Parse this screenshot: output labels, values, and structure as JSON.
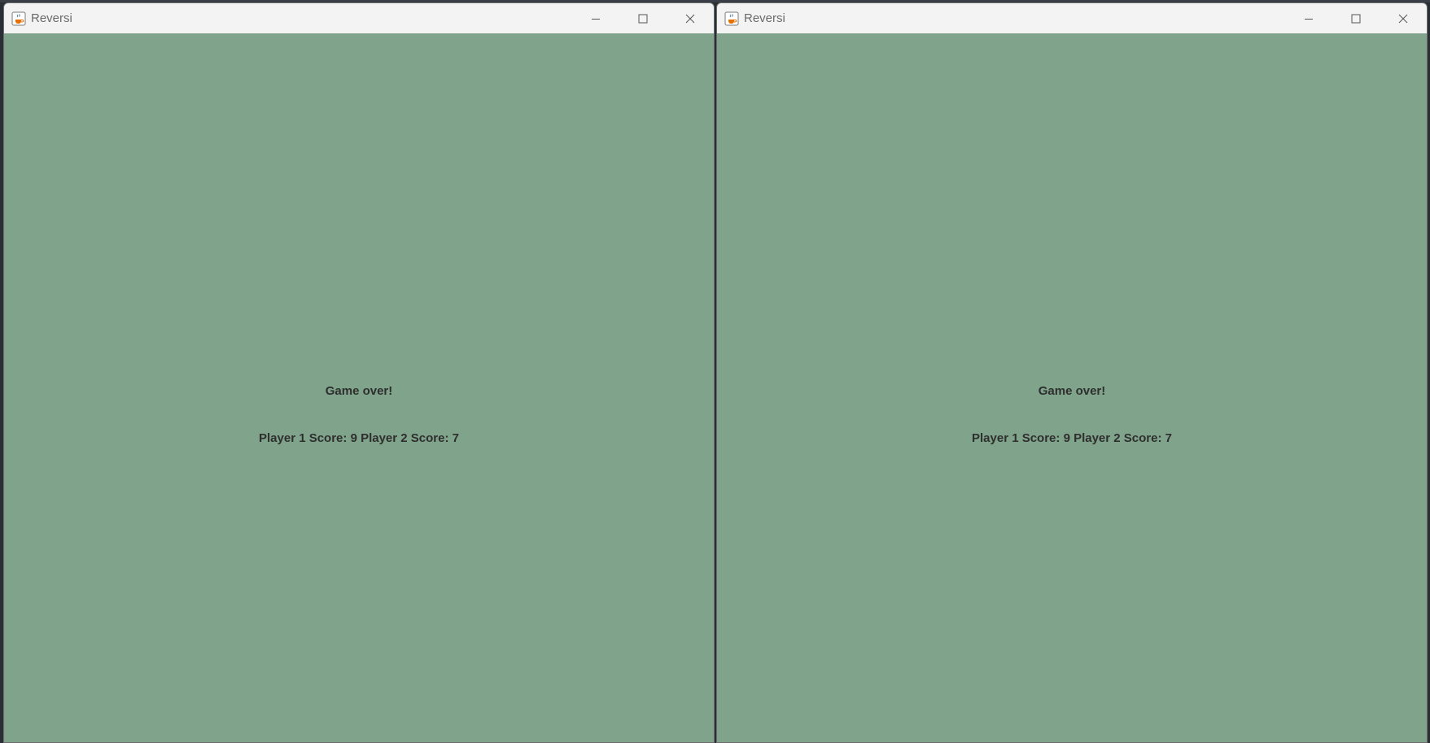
{
  "windows": [
    {
      "title": "Reversi",
      "game_over_text": "Game over!",
      "score_text": "Player 1 Score: 9 Player 2 Score: 7"
    },
    {
      "title": "Reversi",
      "game_over_text": "Game over!",
      "score_text": "Player 1 Score: 9 Player 2 Score: 7"
    }
  ],
  "icons": {
    "app": "java-coffee-cup-icon",
    "minimize": "minimize-icon",
    "maximize": "maximize-icon",
    "close": "close-icon"
  },
  "colors": {
    "board_background": "#80a48b",
    "titlebar": "#f3f3f3",
    "text": "#2e2e2e"
  }
}
